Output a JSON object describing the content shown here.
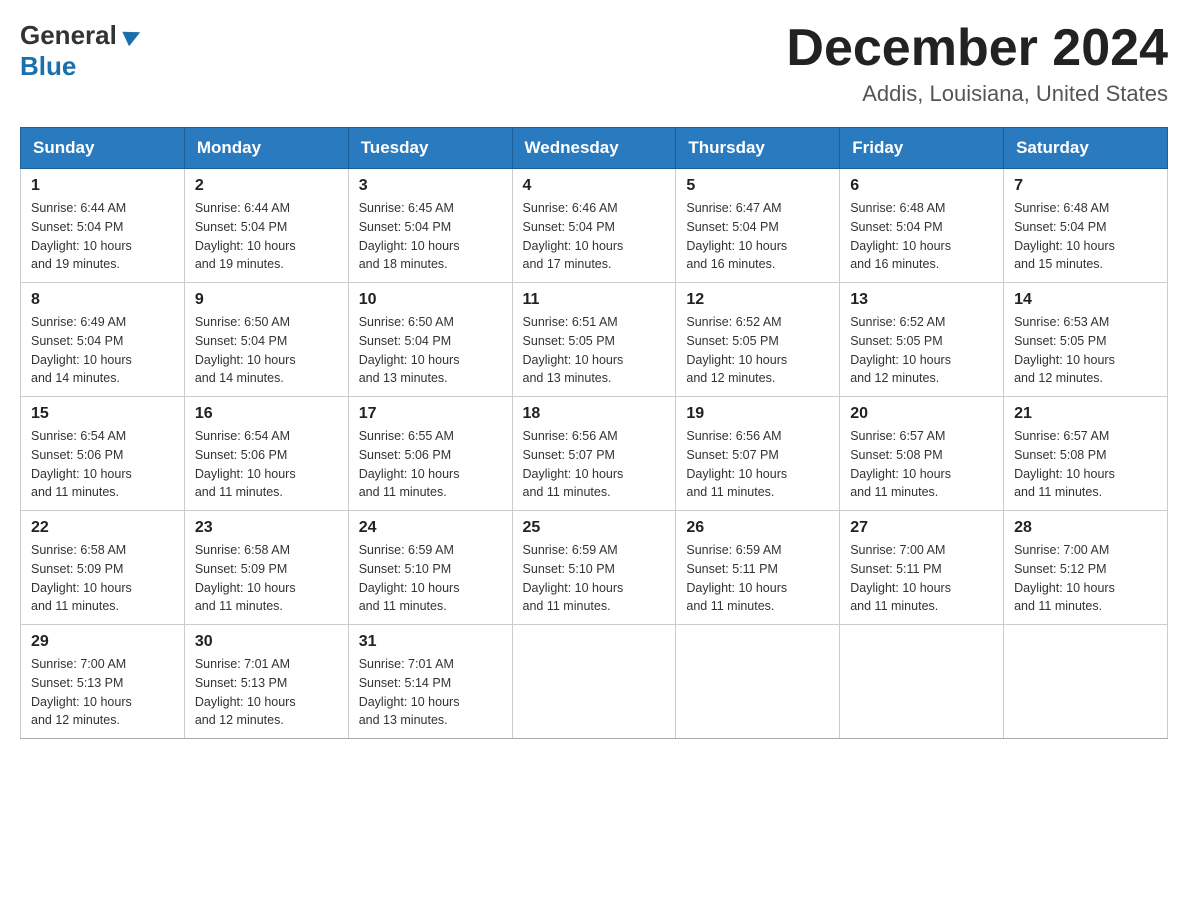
{
  "logo": {
    "general": "General",
    "blue": "Blue",
    "arrow": "▶"
  },
  "header": {
    "month_year": "December 2024",
    "location": "Addis, Louisiana, United States"
  },
  "weekdays": [
    "Sunday",
    "Monday",
    "Tuesday",
    "Wednesday",
    "Thursday",
    "Friday",
    "Saturday"
  ],
  "weeks": [
    [
      {
        "day": "1",
        "sunrise": "6:44 AM",
        "sunset": "5:04 PM",
        "daylight": "10 hours and 19 minutes."
      },
      {
        "day": "2",
        "sunrise": "6:44 AM",
        "sunset": "5:04 PM",
        "daylight": "10 hours and 19 minutes."
      },
      {
        "day": "3",
        "sunrise": "6:45 AM",
        "sunset": "5:04 PM",
        "daylight": "10 hours and 18 minutes."
      },
      {
        "day": "4",
        "sunrise": "6:46 AM",
        "sunset": "5:04 PM",
        "daylight": "10 hours and 17 minutes."
      },
      {
        "day": "5",
        "sunrise": "6:47 AM",
        "sunset": "5:04 PM",
        "daylight": "10 hours and 16 minutes."
      },
      {
        "day": "6",
        "sunrise": "6:48 AM",
        "sunset": "5:04 PM",
        "daylight": "10 hours and 16 minutes."
      },
      {
        "day": "7",
        "sunrise": "6:48 AM",
        "sunset": "5:04 PM",
        "daylight": "10 hours and 15 minutes."
      }
    ],
    [
      {
        "day": "8",
        "sunrise": "6:49 AM",
        "sunset": "5:04 PM",
        "daylight": "10 hours and 14 minutes."
      },
      {
        "day": "9",
        "sunrise": "6:50 AM",
        "sunset": "5:04 PM",
        "daylight": "10 hours and 14 minutes."
      },
      {
        "day": "10",
        "sunrise": "6:50 AM",
        "sunset": "5:04 PM",
        "daylight": "10 hours and 13 minutes."
      },
      {
        "day": "11",
        "sunrise": "6:51 AM",
        "sunset": "5:05 PM",
        "daylight": "10 hours and 13 minutes."
      },
      {
        "day": "12",
        "sunrise": "6:52 AM",
        "sunset": "5:05 PM",
        "daylight": "10 hours and 12 minutes."
      },
      {
        "day": "13",
        "sunrise": "6:52 AM",
        "sunset": "5:05 PM",
        "daylight": "10 hours and 12 minutes."
      },
      {
        "day": "14",
        "sunrise": "6:53 AM",
        "sunset": "5:05 PM",
        "daylight": "10 hours and 12 minutes."
      }
    ],
    [
      {
        "day": "15",
        "sunrise": "6:54 AM",
        "sunset": "5:06 PM",
        "daylight": "10 hours and 11 minutes."
      },
      {
        "day": "16",
        "sunrise": "6:54 AM",
        "sunset": "5:06 PM",
        "daylight": "10 hours and 11 minutes."
      },
      {
        "day": "17",
        "sunrise": "6:55 AM",
        "sunset": "5:06 PM",
        "daylight": "10 hours and 11 minutes."
      },
      {
        "day": "18",
        "sunrise": "6:56 AM",
        "sunset": "5:07 PM",
        "daylight": "10 hours and 11 minutes."
      },
      {
        "day": "19",
        "sunrise": "6:56 AM",
        "sunset": "5:07 PM",
        "daylight": "10 hours and 11 minutes."
      },
      {
        "day": "20",
        "sunrise": "6:57 AM",
        "sunset": "5:08 PM",
        "daylight": "10 hours and 11 minutes."
      },
      {
        "day": "21",
        "sunrise": "6:57 AM",
        "sunset": "5:08 PM",
        "daylight": "10 hours and 11 minutes."
      }
    ],
    [
      {
        "day": "22",
        "sunrise": "6:58 AM",
        "sunset": "5:09 PM",
        "daylight": "10 hours and 11 minutes."
      },
      {
        "day": "23",
        "sunrise": "6:58 AM",
        "sunset": "5:09 PM",
        "daylight": "10 hours and 11 minutes."
      },
      {
        "day": "24",
        "sunrise": "6:59 AM",
        "sunset": "5:10 PM",
        "daylight": "10 hours and 11 minutes."
      },
      {
        "day": "25",
        "sunrise": "6:59 AM",
        "sunset": "5:10 PM",
        "daylight": "10 hours and 11 minutes."
      },
      {
        "day": "26",
        "sunrise": "6:59 AM",
        "sunset": "5:11 PM",
        "daylight": "10 hours and 11 minutes."
      },
      {
        "day": "27",
        "sunrise": "7:00 AM",
        "sunset": "5:11 PM",
        "daylight": "10 hours and 11 minutes."
      },
      {
        "day": "28",
        "sunrise": "7:00 AM",
        "sunset": "5:12 PM",
        "daylight": "10 hours and 11 minutes."
      }
    ],
    [
      {
        "day": "29",
        "sunrise": "7:00 AM",
        "sunset": "5:13 PM",
        "daylight": "10 hours and 12 minutes."
      },
      {
        "day": "30",
        "sunrise": "7:01 AM",
        "sunset": "5:13 PM",
        "daylight": "10 hours and 12 minutes."
      },
      {
        "day": "31",
        "sunrise": "7:01 AM",
        "sunset": "5:14 PM",
        "daylight": "10 hours and 13 minutes."
      },
      null,
      null,
      null,
      null
    ]
  ],
  "labels": {
    "sunrise": "Sunrise:",
    "sunset": "Sunset:",
    "daylight": "Daylight:"
  }
}
